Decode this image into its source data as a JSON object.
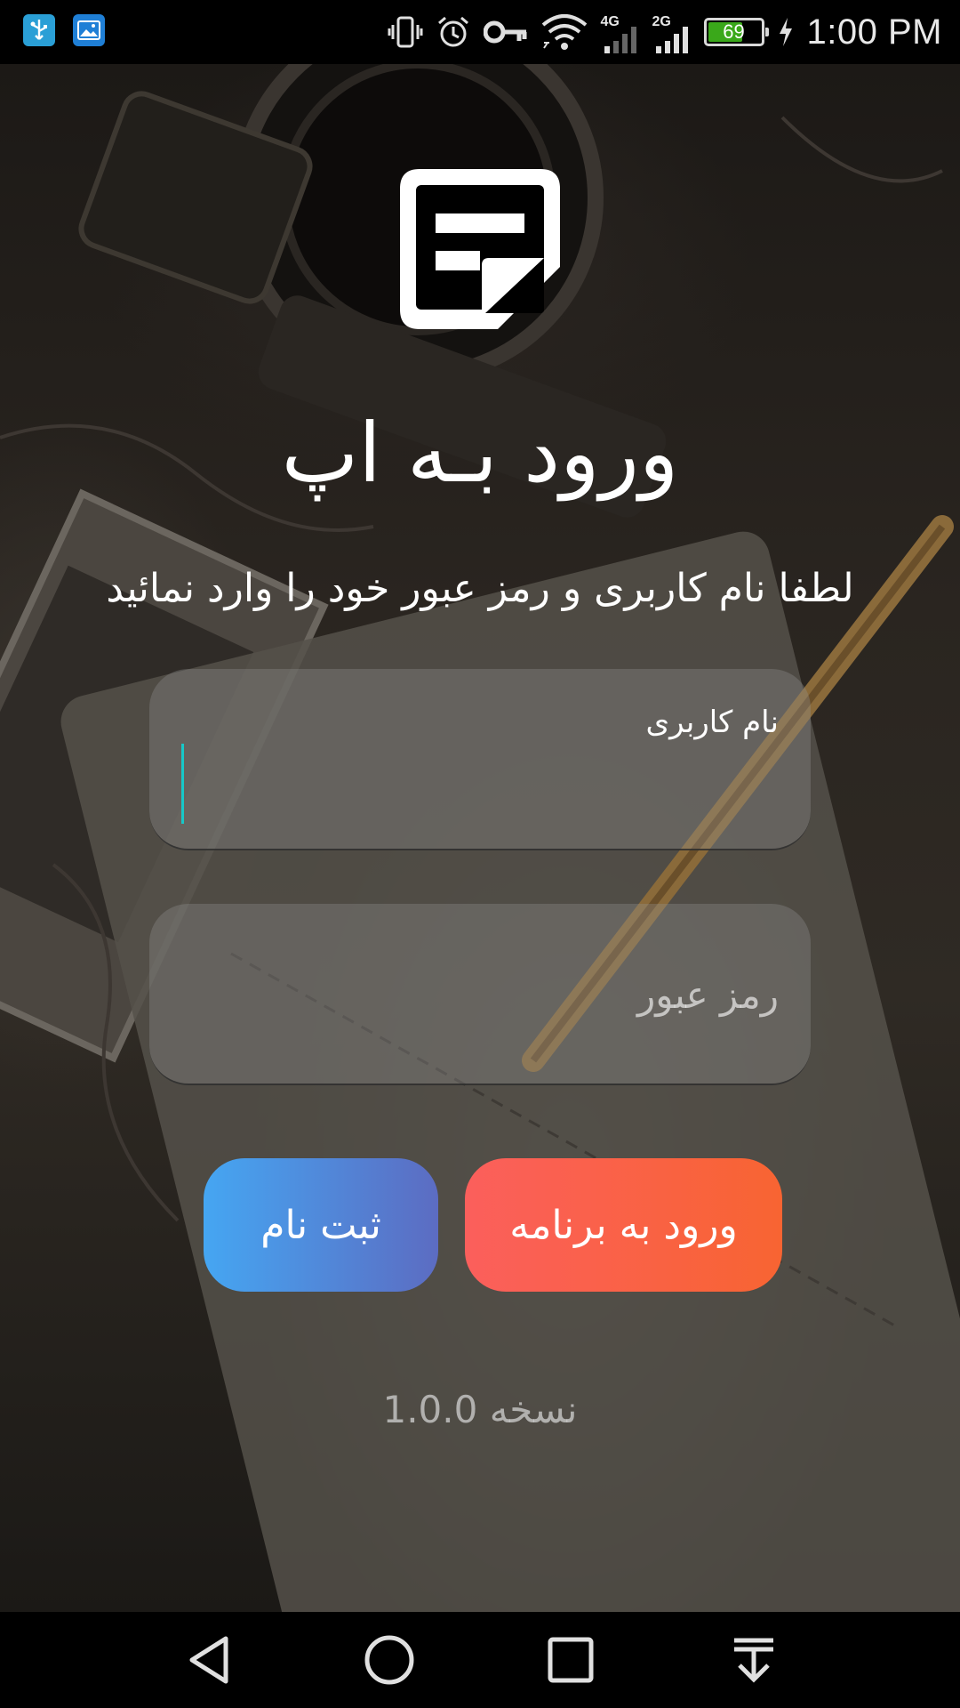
{
  "status_bar": {
    "time": "1:00 PM",
    "battery_level": "69",
    "battery_fraction": 0.69,
    "network_1": "4G",
    "network_2": "2G",
    "left_icons": [
      "usb-icon",
      "gallery-icon"
    ],
    "right_icons": [
      "vibrate-icon",
      "alarm-icon",
      "vpn-key-icon",
      "wifi-icon",
      "signal-4g-icon",
      "signal-2g-icon",
      "battery-icon",
      "charging-icon"
    ]
  },
  "app": {
    "logo_icon": "notes-icon",
    "title": "ورود بـه اپ",
    "subtitle": "لطفا نام کاربری و رمز عبور خود را وارد نمائید"
  },
  "form": {
    "username": {
      "label": "نام کاربری",
      "value": ""
    },
    "password": {
      "placeholder": "رمز عبور",
      "value": ""
    }
  },
  "buttons": {
    "login": "ورود به برنامه",
    "register": "ثبت نام"
  },
  "footer": {
    "version": "نسخه 1.0.0"
  },
  "colors": {
    "login_gradient": [
      "#fb5f5c",
      "#f86432"
    ],
    "register_gradient": [
      "#45a6f2",
      "#5c6cc2"
    ],
    "caret": "#17c8c8"
  },
  "nav_bar": {
    "icons": [
      "back-icon",
      "home-icon",
      "recents-icon",
      "notification-shade-icon"
    ]
  }
}
